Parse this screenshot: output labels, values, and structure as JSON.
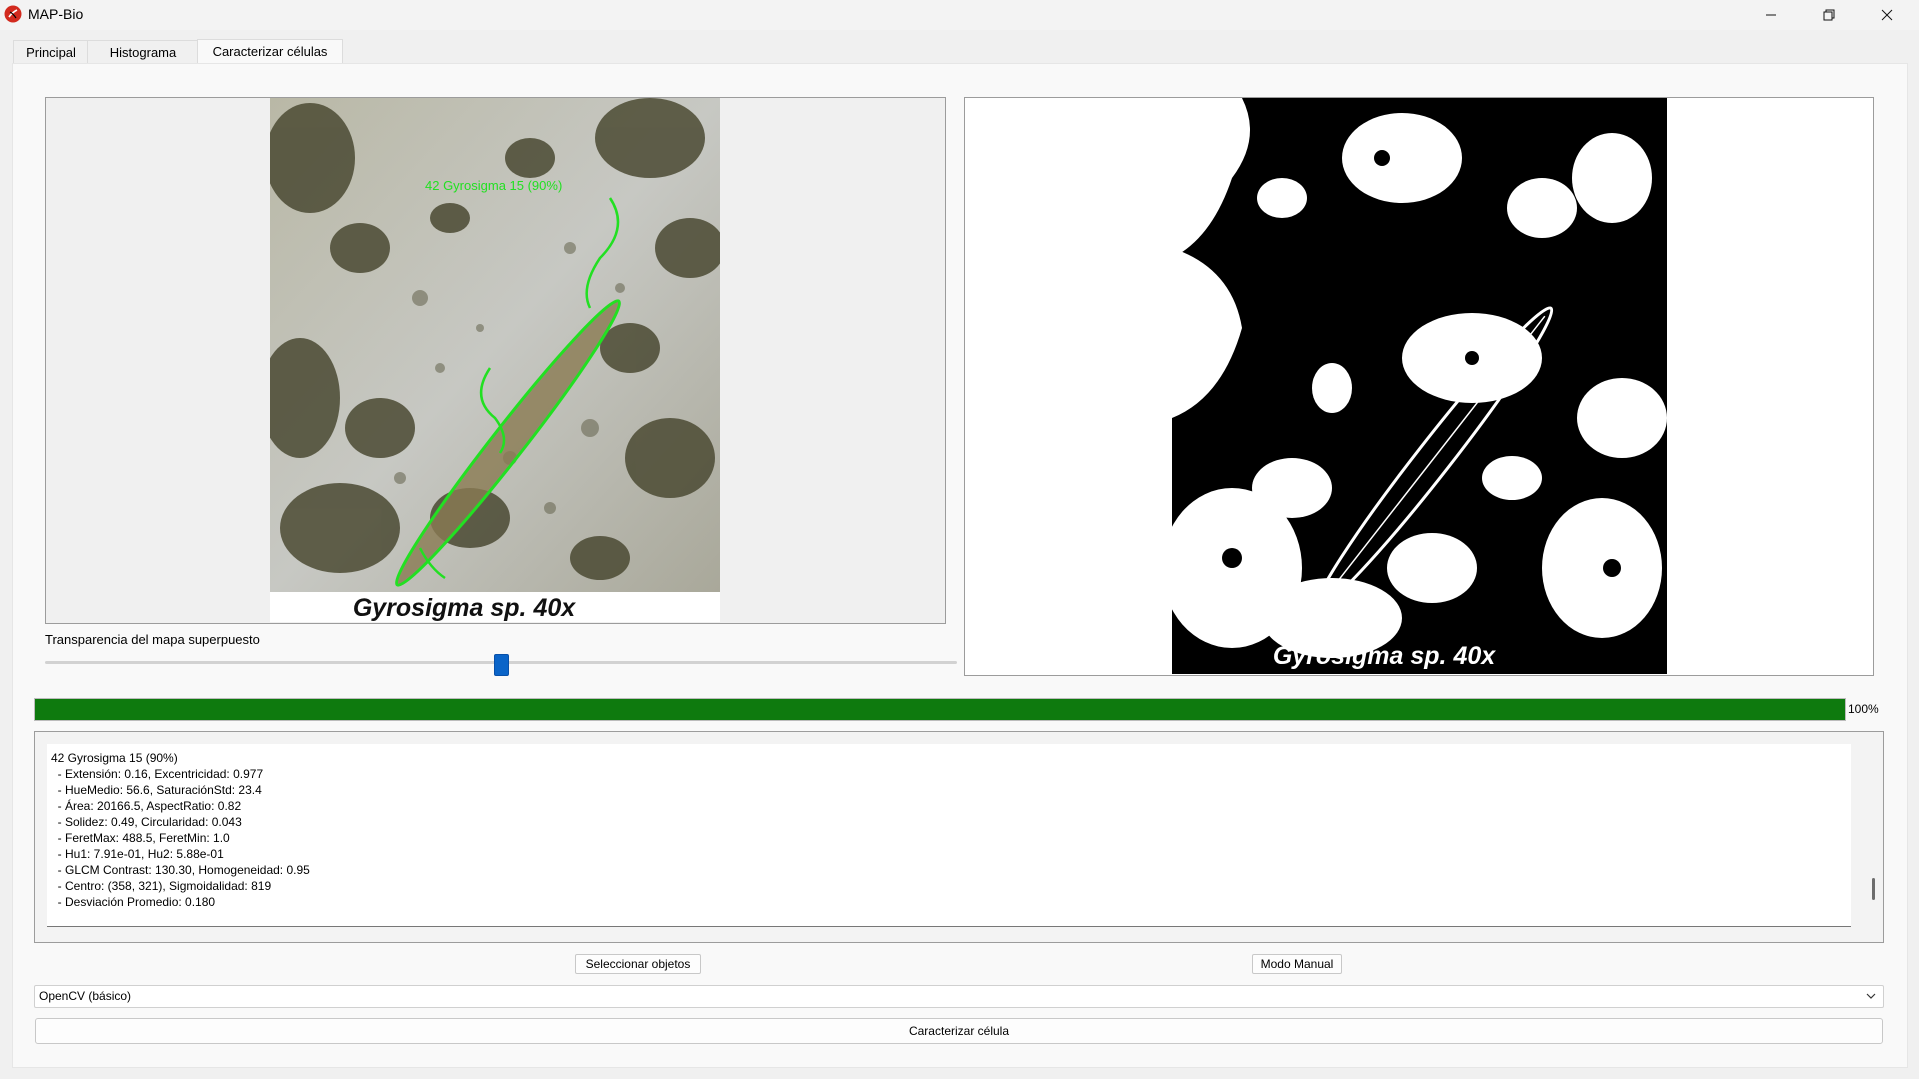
{
  "window": {
    "title": "MAP-Bio"
  },
  "tabs": [
    {
      "label": "Principal"
    },
    {
      "label": "Histograma"
    },
    {
      "label": "Caracterizar células"
    }
  ],
  "left_image": {
    "overlay_label": "42 Gyrosigma 15 (90%)",
    "caption": "Gyrosigma sp. 40x"
  },
  "right_image": {
    "caption": "Gyrosigma sp. 40x"
  },
  "slider": {
    "label": "Transparencia del mapa superpuesto",
    "value_fraction": 0.5
  },
  "progress": {
    "value": 100,
    "text": "100%"
  },
  "output": {
    "lines": [
      "42 Gyrosigma 15 (90%)",
      "  - Extensión: 0.16, Excentricidad: 0.977",
      "  - HueMedio: 56.6, SaturaciónStd: 23.4",
      "  - Área: 20166.5, AspectRatio: 0.82",
      "  - Solidez: 0.49, Circularidad: 0.043",
      "  - FeretMax: 488.5, FeretMin: 1.0",
      "  - Hu1: 7.91e-01, Hu2: 5.88e-01",
      "  - GLCM Contrast: 130.30, Homogeneidad: 0.95",
      "  - Centro: (358, 321), Sigmoidalidad: 819",
      "  - Desviación Promedio: 0.180"
    ]
  },
  "buttons": {
    "select_objects": "Seleccionar objetos",
    "manual_mode": "Modo Manual",
    "characterize": "Caracterizar célula"
  },
  "combo": {
    "selected": "OpenCV (básico)"
  },
  "colors": {
    "progress": "#0e7a0e",
    "slider": "#0a64c8",
    "contour": "#22e022"
  }
}
